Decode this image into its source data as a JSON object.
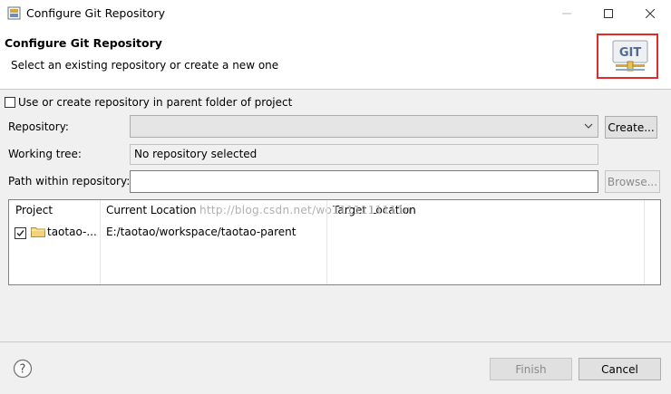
{
  "window": {
    "title": "Configure Git Repository"
  },
  "header": {
    "title": "Configure Git Repository",
    "description": "Select an existing repository or create a new one",
    "logo_text": "GIT",
    "highlight_color": "#e12b2b"
  },
  "form": {
    "parent_checkbox_label": "Use or create repository in parent folder of project",
    "repository_label": "Repository:",
    "repository_value": "",
    "create_button": "Create...",
    "working_tree_label": "Working tree:",
    "working_tree_value": "No repository selected",
    "path_label": "Path within repository:",
    "path_value": "",
    "browse_button": "Browse..."
  },
  "table": {
    "columns": [
      "Project",
      "Current Location",
      "Target Location"
    ],
    "rows": [
      {
        "checked": true,
        "project": "taotao-...",
        "current_location": "E:/taotao/workspace/taotao-parent",
        "target_location": ""
      }
    ],
    "watermark": "http://blog.csdn.net/wo1111111111n"
  },
  "footer": {
    "finish_button": "Finish",
    "cancel_button": "Cancel"
  },
  "icons": {
    "app": "git-repo-icon",
    "help": "help-icon",
    "folder": "folder-icon"
  }
}
